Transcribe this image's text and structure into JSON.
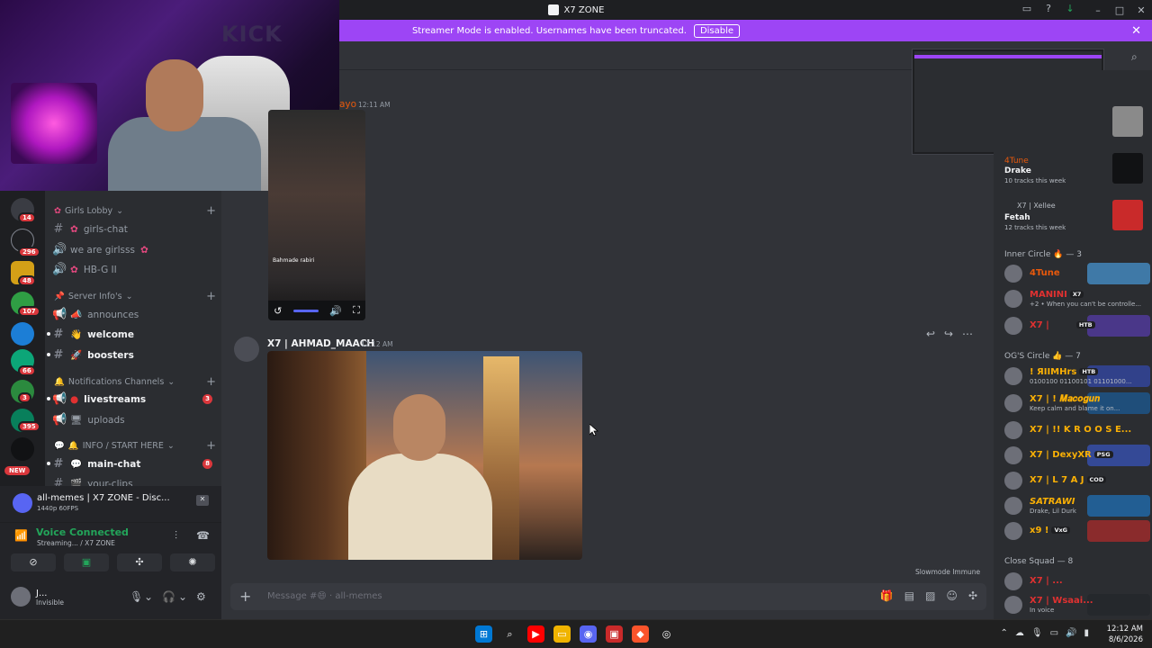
{
  "titlebar": {
    "title": "X7 ZONE"
  },
  "banner": {
    "text": "Streamer Mode is enabled. Usernames have been truncated.",
    "button": "Disable"
  },
  "guilds": {
    "badges": [
      "14",
      "296",
      "48",
      "107",
      "66",
      "3",
      "395"
    ],
    "new_label": "NEW"
  },
  "channels": {
    "categories": {
      "girls_lobby": "Girls Lobby",
      "server_infos": "Server Info's",
      "notifications": "Notifications Channels",
      "info_start": "INFO / START HERE"
    },
    "items": {
      "girls_chat": "girls-chat",
      "we_are_girls": "we are girlsss",
      "hbg": "HB-G II",
      "announces": "announces",
      "welcome": "welcome",
      "boosters": "boosters",
      "livestreams": "livestreams",
      "livestreams_badge": "3",
      "uploads": "uploads",
      "main_chat": "main-chat",
      "main_chat_badge": "8",
      "your_clips": "your-clips"
    }
  },
  "stream": {
    "title": "all-memes | X7 ZONE - Disc...",
    "quality": "1440p 60FPS"
  },
  "voice": {
    "status": "Voice Connected",
    "sub": "Streaming... / X7 ZONE"
  },
  "user": {
    "name": "J...",
    "status": "Invisible"
  },
  "chat": {
    "first_author_fragment": "ayo",
    "first_time": "12:11 AM",
    "video_caption": "Bahmade rabiri",
    "second_author": "X7 | AHMAD_MAACH",
    "second_time": "12:12 AM",
    "slowmode": "Slowmode Immune",
    "placeholder": "Message #😄 · all-memes"
  },
  "activity": {
    "item1_name": "Drake",
    "item1_user": "4Tune",
    "item1_sub": "10 tracks this week",
    "item2_user": "X7 | Xellee",
    "item2_name": "Fetah",
    "item2_sub": "12 tracks this week"
  },
  "members": {
    "inner_circle": "Inner Circle 🔥 — 3",
    "ogs_circle": "OG'S Circle 👍 — 7",
    "close_squad": "Close Squad — 8",
    "rows": [
      {
        "name": "4Tune",
        "status": "",
        "tag": ""
      },
      {
        "name": "MANINI",
        "status": "+2 • When you can't be controlle...",
        "tag": "X7"
      },
      {
        "name": "X7 |",
        "status": "",
        "tag": "HTB"
      },
      {
        "name": "! ЯIIMHrs",
        "status": "0100100 01100101 01101000...",
        "tag": "HTB"
      },
      {
        "name": "X7 | ! 𝑴𝒂𝒄𝒐𝒈𝒖𝒏",
        "status": "Keep calm and blame it on...",
        "tag": ""
      },
      {
        "name": "X7 | !! K R O O S E...",
        "status": "",
        "tag": ""
      },
      {
        "name": "X7 | DexyXR",
        "status": "",
        "tag": "PSG"
      },
      {
        "name": "X7 | L 7 A J",
        "status": "",
        "tag": "COD"
      },
      {
        "name": "SATRAWI",
        "status": "Drake, Lil Durk",
        "tag": ""
      },
      {
        "name": "x9 !",
        "status": "",
        "tag": "VxG"
      },
      {
        "name": "X7 | ...",
        "status": "",
        "tag": ""
      },
      {
        "name": "X7 | Wsaai...",
        "status": "In voice",
        "tag": ""
      }
    ]
  },
  "taskbar": {
    "time": "12:12 AM",
    "date": "8/6/2026"
  },
  "colors": {
    "accent": "#9d45f5",
    "bg": "#313338",
    "sidebar": "#2b2d31"
  }
}
